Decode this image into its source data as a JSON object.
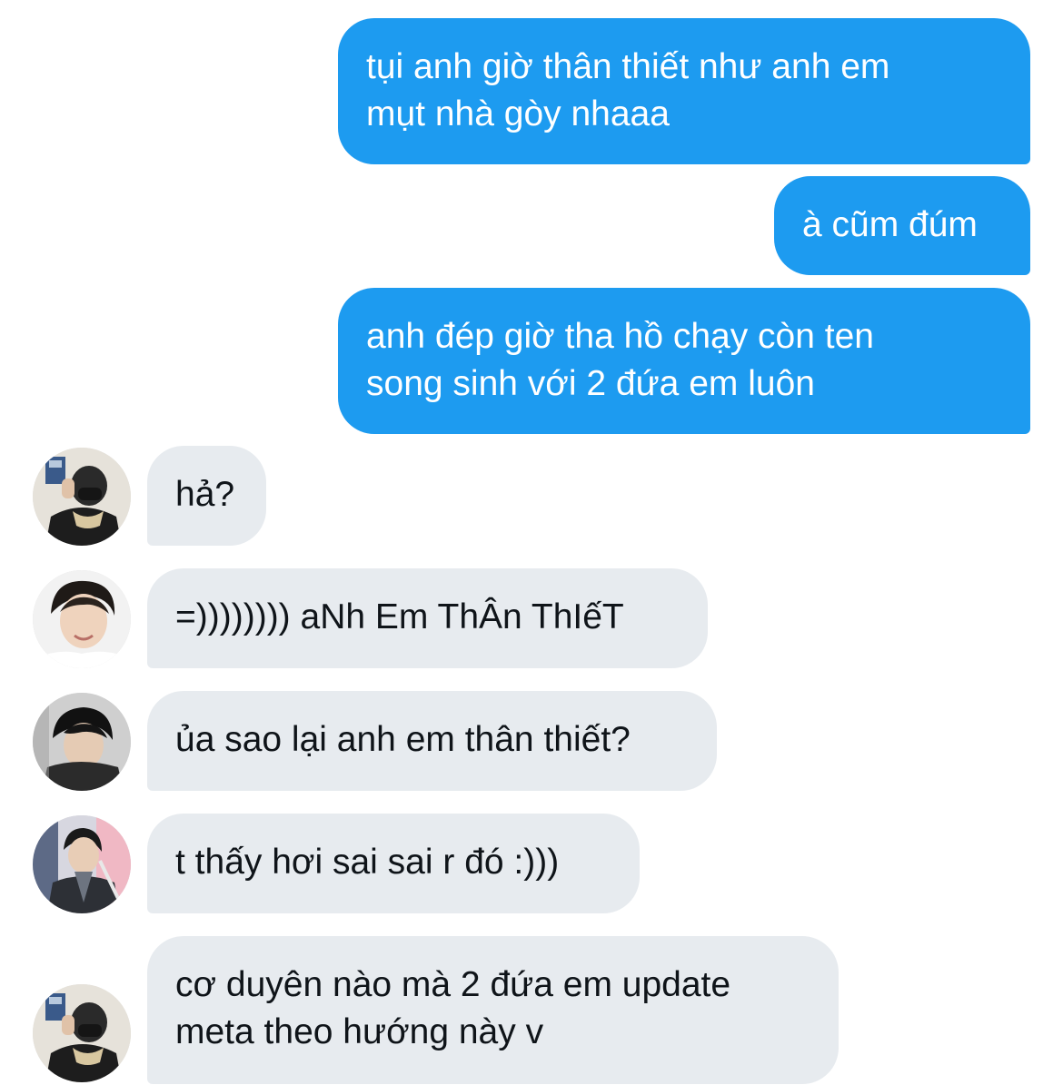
{
  "conversation": {
    "messages": [
      {
        "direction": "outgoing",
        "text": "tụi anh giờ thân thiết như anh em\nmụt nhà gòy nhaaa"
      },
      {
        "direction": "outgoing",
        "text": "à cũm đúm"
      },
      {
        "direction": "outgoing",
        "text": "anh đép giờ tha hồ chạy còn ten\nsong sinh với 2 đứa em luôn"
      },
      {
        "direction": "incoming",
        "text": "hả?",
        "avatar": "user-avatar-1"
      },
      {
        "direction": "incoming",
        "text": "=)))))))) aNh Em ThÂn ThIếT",
        "avatar": "user-avatar-2"
      },
      {
        "direction": "incoming",
        "text": "ủa sao lại anh em thân thiết?",
        "avatar": "user-avatar-3"
      },
      {
        "direction": "incoming",
        "text": "t thấy hơi sai sai r đó :)))",
        "avatar": "user-avatar-4"
      },
      {
        "direction": "incoming",
        "text": "cơ duyên nào mà 2 đứa em update\nmeta theo hướng này v",
        "avatar": "user-avatar-1"
      }
    ]
  },
  "colors": {
    "outgoing_bubble": "#1d9bf0",
    "incoming_bubble": "#e7ebef",
    "outgoing_text": "#ffffff",
    "incoming_text": "#0f1419"
  }
}
